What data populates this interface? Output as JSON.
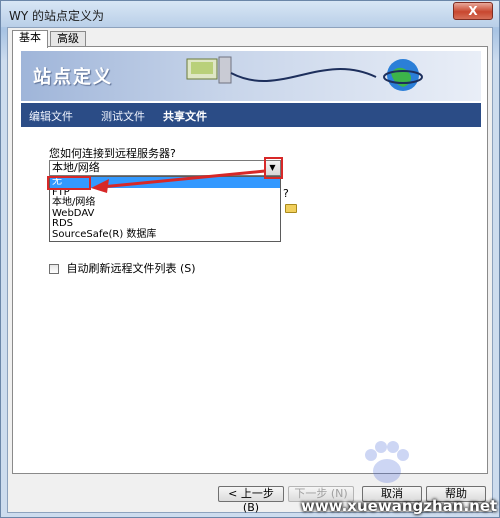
{
  "window": {
    "title": "WY 的站点定义为",
    "close_label": "X"
  },
  "tabs": [
    {
      "label": "基本",
      "active": true
    },
    {
      "label": "高级",
      "active": false
    }
  ],
  "banner": {
    "title": "站点定义"
  },
  "subnav": {
    "items": [
      {
        "label": "编辑文件"
      },
      {
        "label": "测试文件"
      },
      {
        "label": "共享文件",
        "active": true
      }
    ]
  },
  "form": {
    "question": "您如何连接到远程服务器?",
    "combo_value": "本地/网络",
    "stub_question": "?",
    "options": [
      {
        "label": "无",
        "selected": true
      },
      {
        "label": "FTP"
      },
      {
        "label": "本地/网络"
      },
      {
        "label": "WebDAV"
      },
      {
        "label": "RDS"
      },
      {
        "label": "SourceSafe(R) 数据库"
      }
    ],
    "checkbox_label": "自动刷新远程文件列表 (S)",
    "checkbox_checked": false
  },
  "buttons": {
    "back": "< 上一步 (B)",
    "next": "下一步 (N) >",
    "cancel": "取消",
    "help": "帮助"
  },
  "watermark": "www.xuewangzhan.net",
  "colors": {
    "selection": "#3399ff",
    "annotation": "#d72828",
    "subnav": "#2b4c86"
  }
}
